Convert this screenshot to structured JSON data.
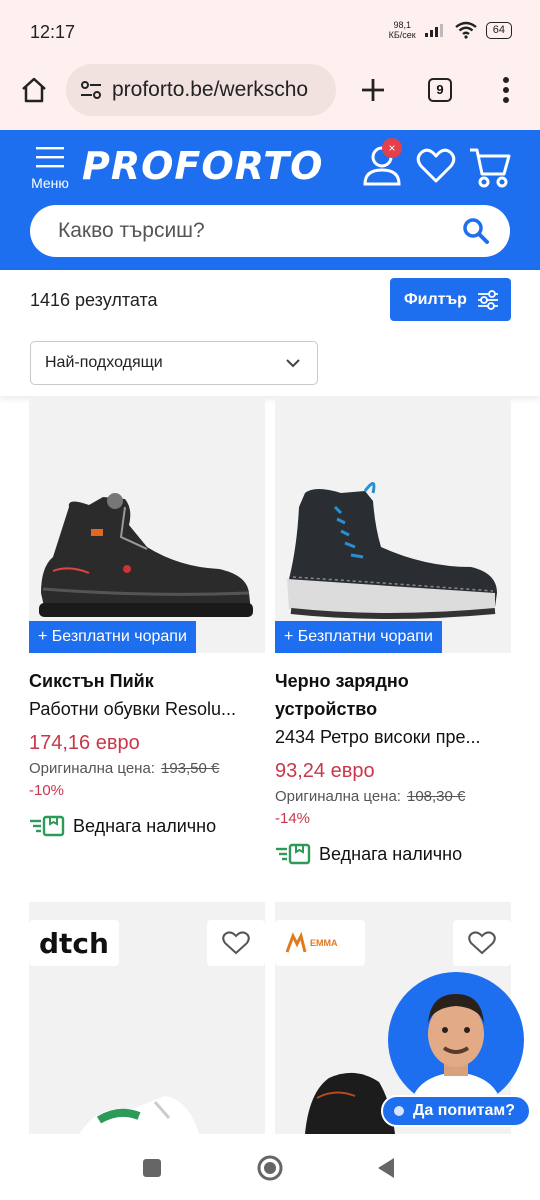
{
  "status": {
    "time": "12:17",
    "net_speed_value": "98,1",
    "net_speed_unit": "КБ/сек",
    "battery": "64"
  },
  "browser": {
    "url": "proforto.be/werkscho",
    "tabs": "9"
  },
  "header": {
    "menu_label": "Меню",
    "logo": "PROFORTO",
    "account_badge": "×",
    "search_placeholder": "Какво търсиш?"
  },
  "results": {
    "count": "1416 резултата",
    "filter_label": "Филтър",
    "sort_value": "Най-подходящи"
  },
  "products": [
    {
      "promo": "+ Безплатни чорапи",
      "title": "Сикстън Пийк",
      "subtitle": "Работни обувки Resolu...",
      "price": "174,16 евро",
      "original_label": "Оригинална цена:",
      "original_price": "193,50 €",
      "discount": "-10%",
      "stock": "Веднага налично"
    },
    {
      "promo": "+ Безплатни чорапи",
      "title": "Черно зарядно устройство",
      "subtitle": "2434 Ретро високи пре...",
      "price": "93,24 евро",
      "original_label": "Оригинална цена:",
      "original_price": "108,30 €",
      "discount": "-14%",
      "stock": "Веднага налично"
    }
  ],
  "lower_cards": [
    {
      "brand": "dtch"
    },
    {
      "brand": "EMMA"
    }
  ],
  "chat": {
    "label": "Да попитам?"
  },
  "colors": {
    "brand_blue": "#1e6ff0",
    "price_red": "#c8384a",
    "stock_green": "#2e9a57"
  }
}
